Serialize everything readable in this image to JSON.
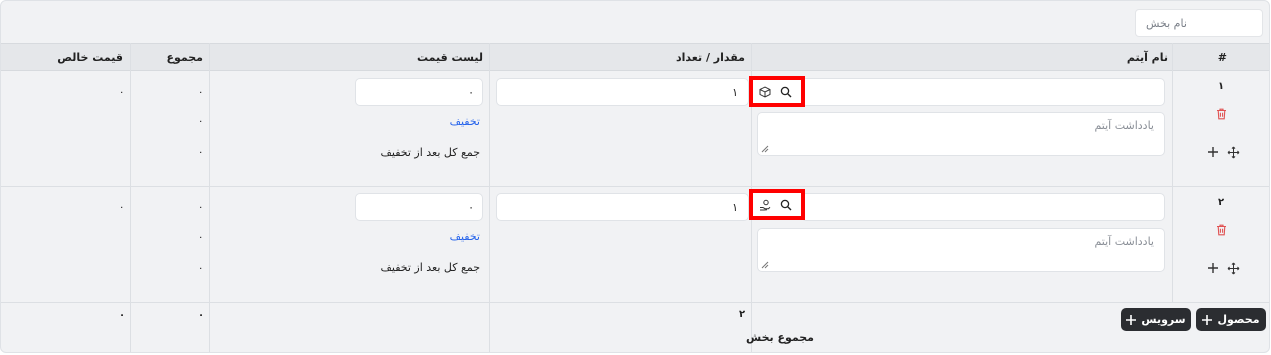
{
  "section": {
    "name_placeholder": "نام بخش"
  },
  "columns": {
    "index": "#",
    "item_name": "نام آیتم",
    "quantity": "مقدار / تعداد",
    "price_list": "لیست قیمت",
    "total": "مجموع",
    "net_price": "قیمت خالص"
  },
  "rows": [
    {
      "index": "۱",
      "quantity": "۱",
      "price": "۰",
      "note_placeholder": "یادداشت آیتم",
      "discount_label": "تخفیف",
      "after_discount_label": "جمع کل بعد از تخفیف",
      "total_price": "۰",
      "total_discount": "۰",
      "total_after": "۰",
      "net_price": "۰",
      "type_icon": "box-icon"
    },
    {
      "index": "۲",
      "quantity": "۱",
      "price": "۰",
      "note_placeholder": "یادداشت آیتم",
      "discount_label": "تخفیف",
      "after_discount_label": "جمع کل بعد از تخفیف",
      "total_price": "۰",
      "total_discount": "۰",
      "total_after": "۰",
      "net_price": "۰",
      "type_icon": "service-hand-icon"
    }
  ],
  "footer": {
    "add_product": "محصول",
    "add_service": "سرویس",
    "section_total_label": "مجموع بخش",
    "quantity_total": "۲",
    "total": "۰",
    "net_price": "۰"
  },
  "colors": {
    "highlight": "#ff0000",
    "link": "#2563eb",
    "delete": "#e05252",
    "button_bg": "#2b2d31"
  }
}
